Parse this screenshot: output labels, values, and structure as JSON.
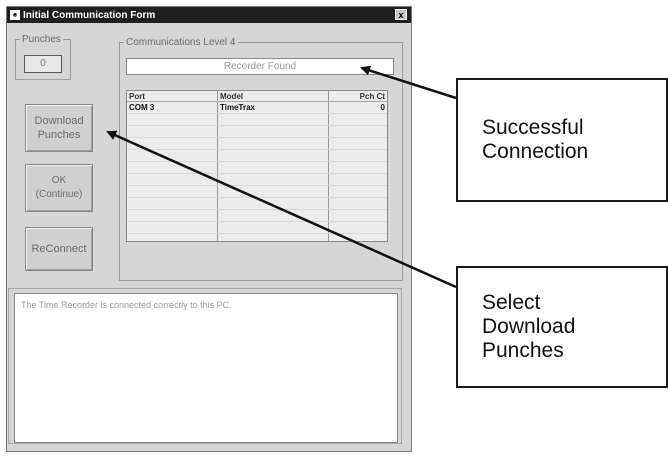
{
  "window": {
    "title": "Initial Communication Form",
    "close_label": "x"
  },
  "punches": {
    "legend": "Punches",
    "value": "0"
  },
  "communications": {
    "legend": "Communications Level 4",
    "status": "Recorder Found",
    "columns": [
      "Port",
      "Model",
      "Pch Ct"
    ],
    "rows": [
      {
        "port": "COM 3",
        "model": "TimeTrax",
        "count": "0"
      }
    ]
  },
  "buttons": {
    "download_line1": "Download",
    "download_line2": "Punches",
    "ok_line1": "OK",
    "ok_line2": "(Continue)",
    "reconnect": "ReConnect"
  },
  "message": "The Time Recorder is connected correctly to this PC.",
  "callouts": {
    "connection_line1": "Successful",
    "connection_line2": "Connection",
    "download_line1": "Select",
    "download_line2": "Download",
    "download_line3": "Punches"
  }
}
